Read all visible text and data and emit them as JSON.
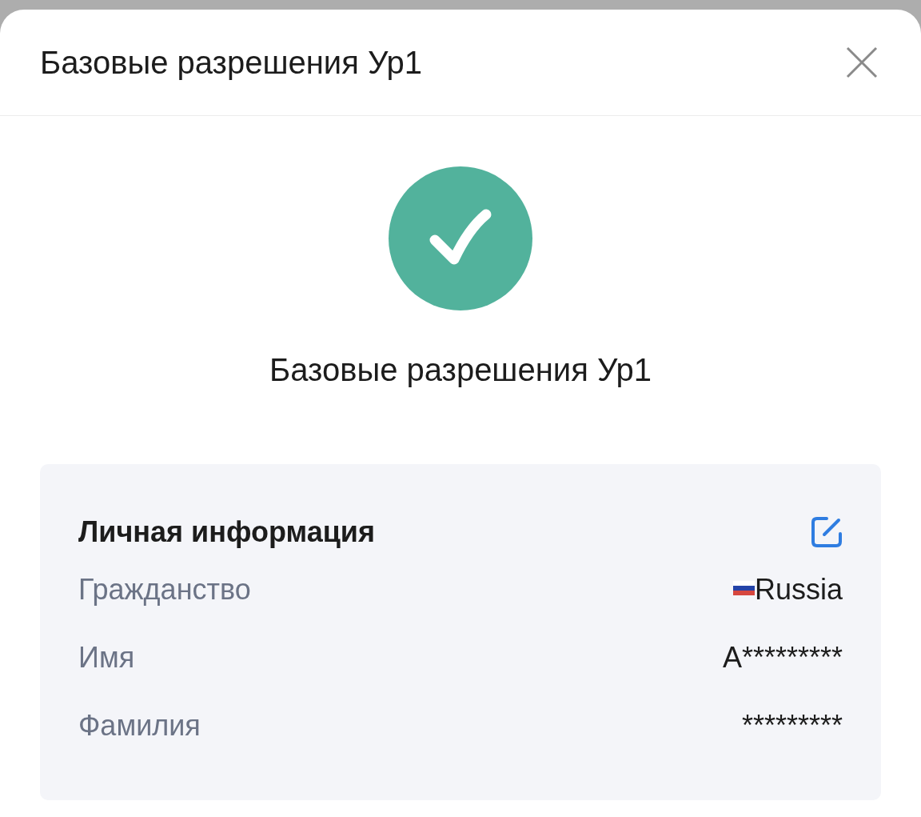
{
  "header": {
    "title": "Базовые разрешения Ур1"
  },
  "status": {
    "kind": "success",
    "title": "Базовые разрешения Ур1"
  },
  "personal_info": {
    "title": "Личная информация",
    "rows": [
      {
        "kind": "country",
        "label": "Гражданство",
        "value": "Russia"
      },
      {
        "kind": "text",
        "label": "Имя",
        "value": "A*********"
      },
      {
        "kind": "text",
        "label": "Фамилия",
        "value": "*********"
      }
    ]
  }
}
